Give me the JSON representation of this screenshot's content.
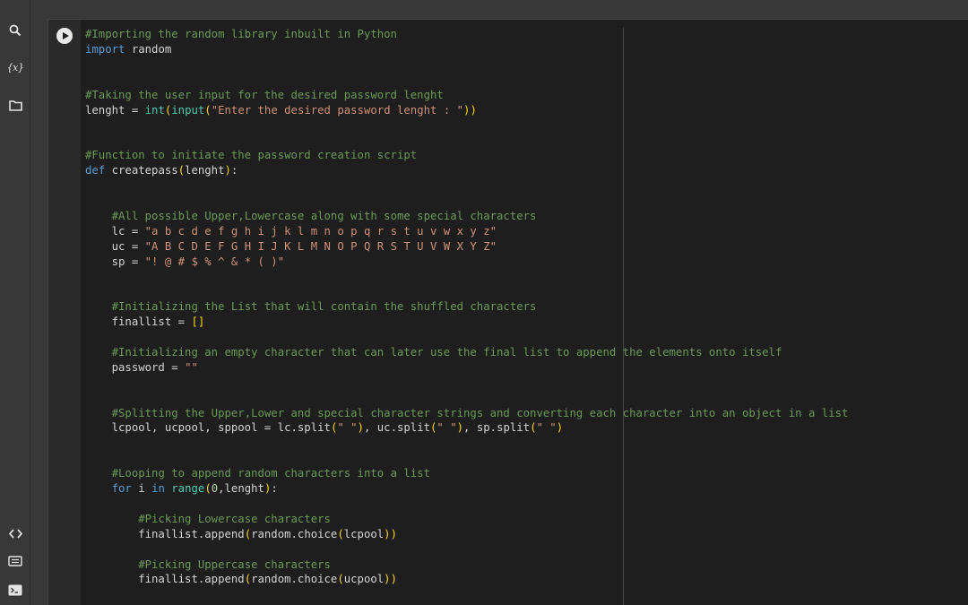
{
  "sidebar": {
    "top_icons": [
      "search-icon",
      "variables-icon",
      "folder-icon"
    ],
    "variables_label": "{x}",
    "bottom_icons": [
      "code-snippets-icon",
      "command-palette-icon",
      "terminal-icon"
    ]
  },
  "cell": {
    "run_icon": "play-icon",
    "lines": [
      "#Importing the random library inbuilt in Python",
      "import random",
      "",
      "",
      "#Taking the user input for the desired password lenght",
      "lenght = int(input(\"Enter the desired password lenght : \"))",
      "",
      "",
      "#Function to initiate the password creation script",
      "def createpass(lenght):",
      "",
      "",
      "    #All possible Upper,Lowercase along with some special characters",
      "    lc = \"a b c d e f g h i j k l m n o p q r s t u v w x y z\"",
      "    uc = \"A B C D E F G H I J K L M N O P Q R S T U V W X Y Z\"",
      "    sp = \"! @ # $ % ^ & * ( )\"",
      "",
      "",
      "    #Initializing the List that will contain the shuffled characters",
      "    finallist = []",
      "",
      "    #Initializing an empty character that can later use the final list to append the elements onto itself",
      "    password = \"\"",
      "",
      "",
      "    #Splitting the Upper,Lower and special character strings and converting each character into an object in a list",
      "    lcpool, ucpool, sppool = lc.split(\" \"), uc.split(\" \"), sp.split(\" \")",
      "",
      "",
      "    #Looping to append random characters into a list",
      "    for i in range(0,lenght):",
      "",
      "        #Picking Lowercase characters",
      "        finallist.append(random.choice(lcpool))",
      "",
      "        #Picking Uppercase characters",
      "        finallist.append(random.choice(ucpool))"
    ]
  }
}
